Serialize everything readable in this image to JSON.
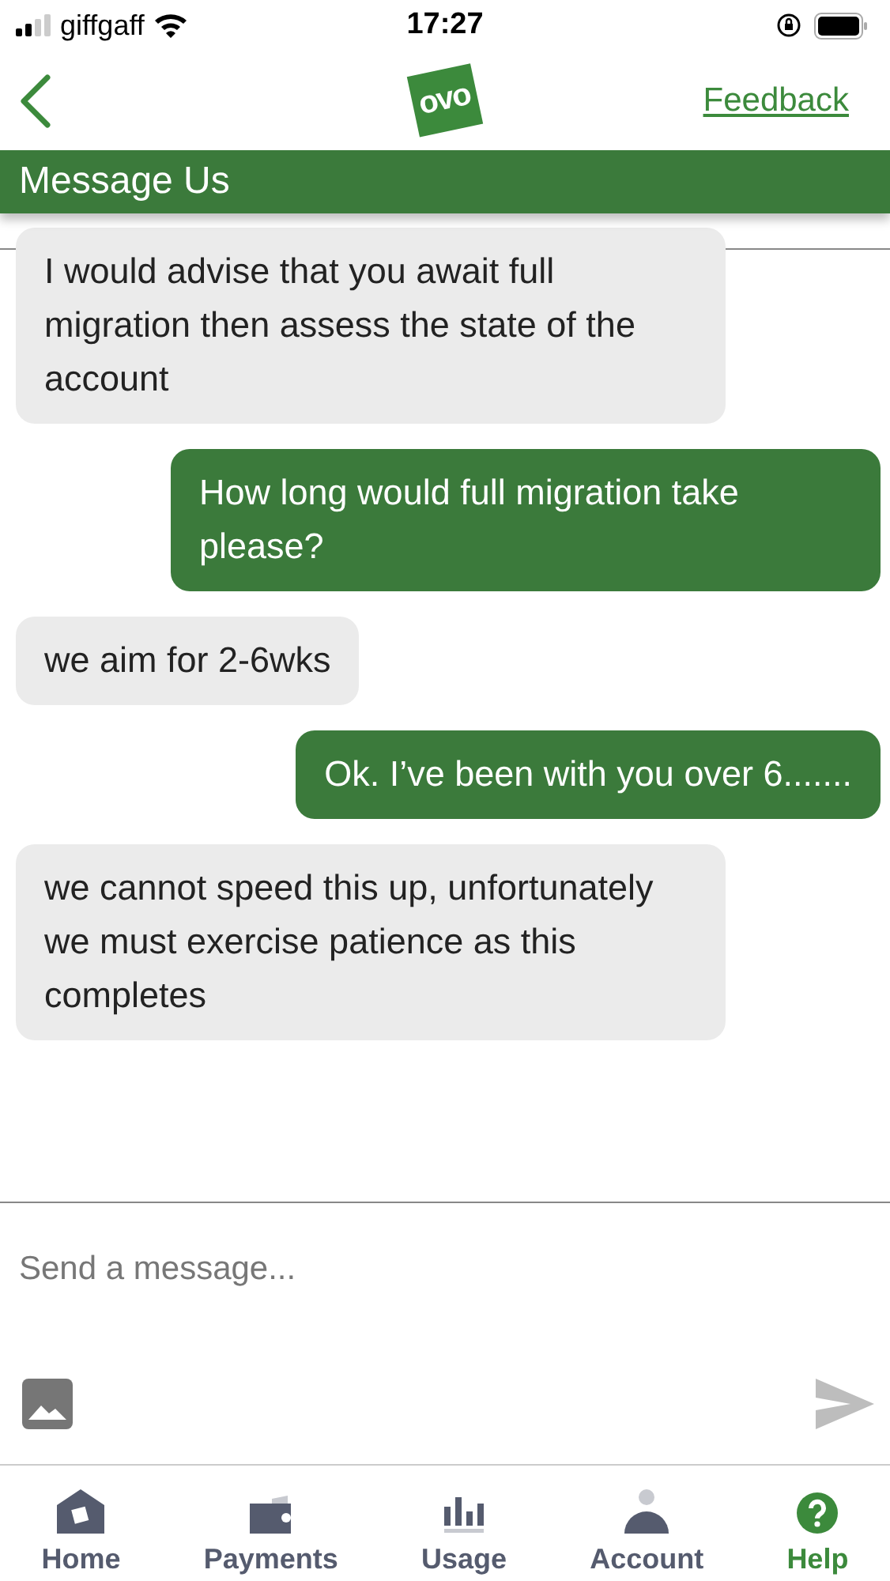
{
  "status_bar": {
    "carrier": "giffgaff",
    "time": "17:27"
  },
  "header": {
    "logo": "ovo",
    "action": "Feedback",
    "title": "Message Us"
  },
  "messages": [
    {
      "kind": "received",
      "text": "I would advise that you await full migration then assess the state of the account"
    },
    {
      "kind": "sent",
      "text": "How long would full migration take please?"
    },
    {
      "kind": "received",
      "text": "we aim for 2-6wks"
    },
    {
      "kind": "sent",
      "text": "Ok. I’ve been with you over 6......."
    },
    {
      "kind": "received",
      "text": "we cannot speed this up, unfortunately we must exercise patience as this completes"
    }
  ],
  "composer": {
    "placeholder": "Send a message..."
  },
  "nav": [
    {
      "label": "Home",
      "kind": "home",
      "selected": false
    },
    {
      "label": "Payments",
      "kind": "wallet",
      "selected": false
    },
    {
      "label": "Usage",
      "kind": "usage",
      "selected": false
    },
    {
      "label": "Account",
      "kind": "account",
      "selected": false
    },
    {
      "label": "Help",
      "kind": "help",
      "selected": true
    }
  ]
}
